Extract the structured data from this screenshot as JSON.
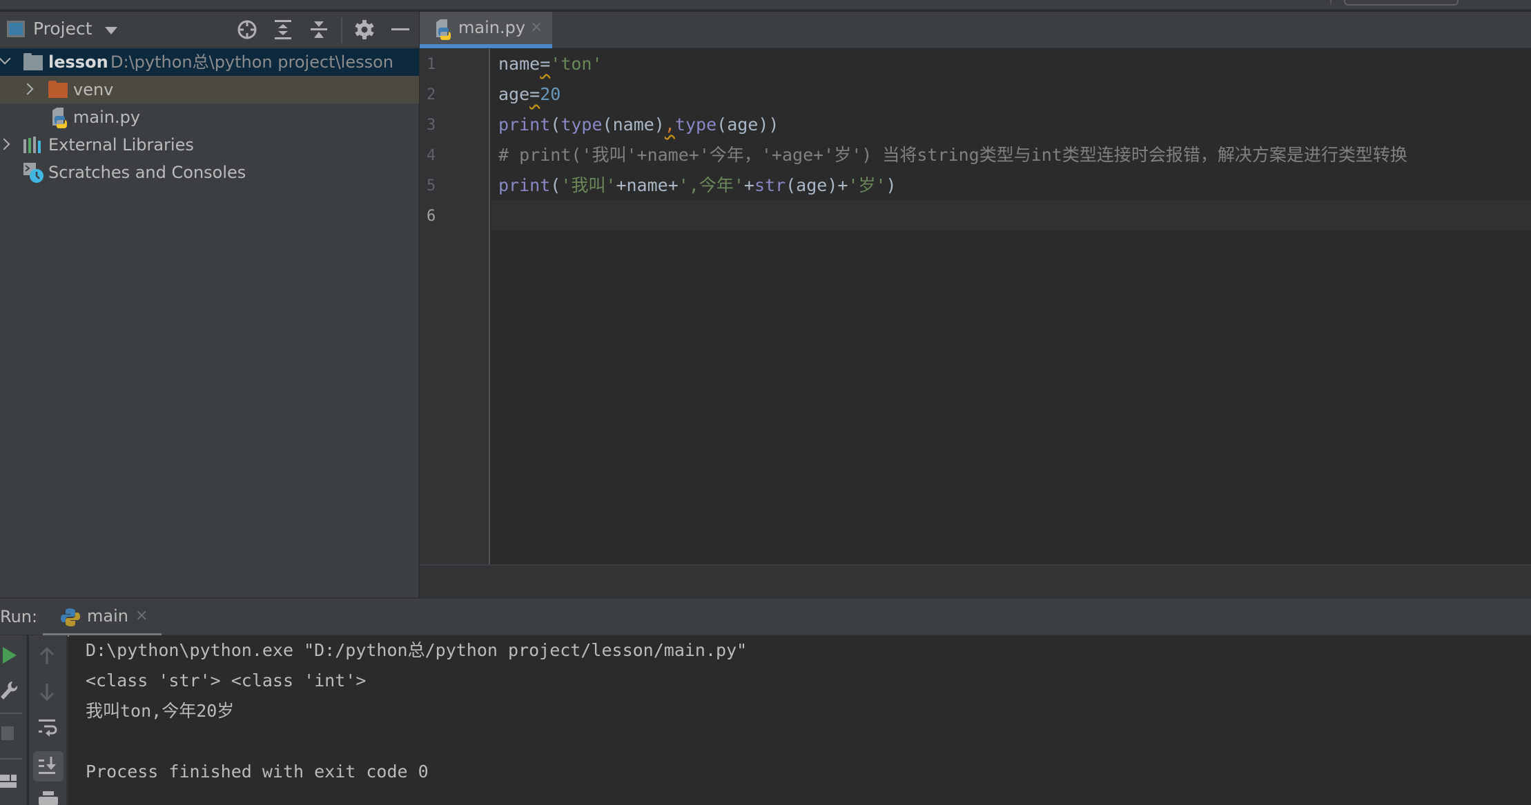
{
  "project_panel": {
    "title": "Project",
    "toolbar_icons": [
      "locate-icon",
      "expand-all-icon",
      "collapse-all-icon",
      "gear-icon",
      "minimize-icon"
    ],
    "tree": [
      {
        "label": "lesson",
        "path": "D:\\python总\\python project\\lesson",
        "type": "folder",
        "expanded": true,
        "selected": true
      },
      {
        "label": "venv",
        "type": "excluded-folder",
        "expanded": false
      },
      {
        "label": "main.py",
        "type": "python-file"
      },
      {
        "label": "External Libraries",
        "type": "libraries",
        "expanded": false
      },
      {
        "label": "Scratches and Consoles",
        "type": "scratches"
      }
    ]
  },
  "editor": {
    "tab": {
      "label": "main.py",
      "close": "×"
    },
    "line_numbers": [
      "1",
      "2",
      "3",
      "4",
      "5",
      "6"
    ],
    "current_line": 6,
    "lines": {
      "l1": {
        "a": "name",
        "b": "=",
        "c": "'ton'"
      },
      "l2": {
        "a": "age",
        "b": "=",
        "c": "20"
      },
      "l3": {
        "a": "print",
        "b": "(",
        "c": "type",
        "d": "(name)",
        "e": ",",
        "f": "type",
        "g": "(age))"
      },
      "l4": {
        "text": "# print('我叫'+name+'今年，'+age+'岁') 当将string类型与int类型连接时会报错，解决方案是进行类型转换"
      },
      "l5": {
        "a": "print",
        "b": "(",
        "c": "'我叫'",
        "d": "+name+",
        "e": "',今年'",
        "f": "+",
        "g": "str",
        "h": "(age)+",
        "i": "'岁'",
        "j": ")"
      }
    }
  },
  "run_panel": {
    "label": "Run:",
    "tab": {
      "label": "main",
      "close": "×"
    },
    "output": [
      "D:\\python\\python.exe \"D:/python总/python project/lesson/main.py\"",
      "<class 'str'> <class 'int'>",
      "我叫ton,今年20岁",
      "",
      "Process finished with exit code 0"
    ]
  },
  "colors": {
    "accent": "#4a88c7",
    "selection": "#0d293e",
    "string": "#6a8759",
    "number": "#6897bb",
    "builtin": "#8888c6",
    "comment": "#808080",
    "run_green": "#499c54"
  }
}
